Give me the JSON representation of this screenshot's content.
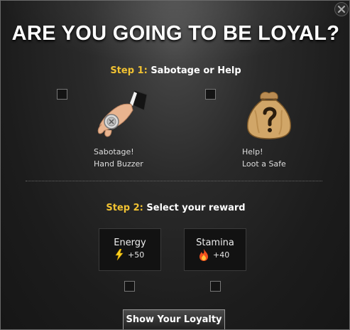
{
  "dialog": {
    "title": "ARE YOU GOING TO BE LOYAL?"
  },
  "step1": {
    "number": "Step 1:",
    "text": " Sabotage or Help",
    "options": [
      {
        "line1": "Sabotage!",
        "line2": "Hand Buzzer",
        "icon": "hand-buzzer-icon",
        "checked": false
      },
      {
        "line1": "Help!",
        "line2": "Loot a Safe",
        "icon": "loot-bag-icon",
        "checked": false
      }
    ]
  },
  "step2": {
    "number": "Step 2:",
    "text": " Select your reward",
    "rewards": [
      {
        "name": "Energy",
        "value": "+50",
        "icon": "lightning-bolt-icon",
        "checked": false
      },
      {
        "name": "Stamina",
        "value": "+40",
        "icon": "flame-icon",
        "checked": false
      }
    ]
  },
  "submit": {
    "label": "Show Your Loyalty"
  },
  "colors": {
    "step_number": "#f1c232",
    "background": "#1e1e1e",
    "text": "#ffffff"
  }
}
